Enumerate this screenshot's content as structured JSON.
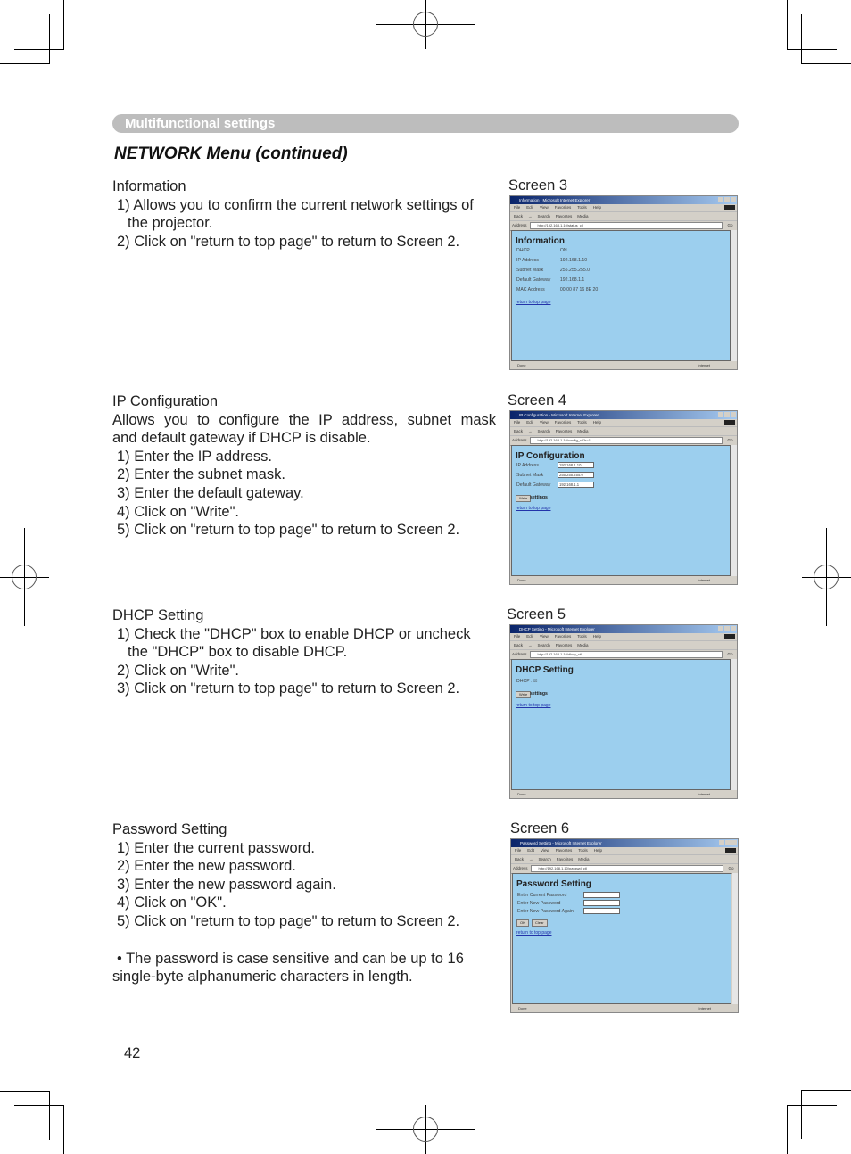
{
  "header": {
    "section": "Multifunctional settings",
    "title": "NETWORK Menu (continued)"
  },
  "sections": [
    {
      "heading": "Information",
      "lines": [
        "1) Allows you to confirm the current network settings of",
        "the projector.",
        "2) Click on \"return to top page\" to return to Screen 2."
      ],
      "screen_label": "Screen 3"
    },
    {
      "heading": "IP Configuration",
      "lines": [
        "Allows you to configure the IP address, subnet mask",
        "and default gateway if DHCP is disable.",
        "1) Enter the IP address.",
        "2) Enter the subnet mask.",
        "3) Enter the default gateway.",
        "4) Click on \"Write\".",
        "5) Click on \"return to top page\" to return to Screen 2."
      ],
      "screen_label": "Screen 4"
    },
    {
      "heading": "DHCP Setting",
      "lines": [
        "1) Check the \"DHCP\" box to enable DHCP or uncheck",
        "the \"DHCP\" box to disable DHCP.",
        "2) Click on \"Write\".",
        "3) Click on \"return to top page\" to return to Screen 2."
      ],
      "screen_label": "Screen 5"
    },
    {
      "heading": "Password Setting",
      "lines": [
        "1) Enter the current password.",
        "2) Enter the new password.",
        "3) Enter the new password again.",
        "4) Click on \"OK\".",
        "5) Click on \"return to top page\" to return to Screen 2."
      ],
      "note": [
        "• The password is case sensitive and can be up to 16",
        "single-byte alphanumeric characters in length."
      ],
      "screen_label": "Screen 6"
    }
  ],
  "browser": {
    "menu": [
      "File",
      "Edit",
      "View",
      "Favorites",
      "Tools",
      "Help"
    ],
    "toolbar": [
      "Back",
      "→",
      "Search",
      "Favorites",
      "Media"
    ],
    "address_label": "Address",
    "go_label": "Go",
    "status_done": "Done",
    "status_zone": "Internet",
    "return_link": "return to top page"
  },
  "screens": {
    "info": {
      "window_title": "Information - Microsoft Internet Explorer",
      "address": "http://192.168.1.10/status_ctl",
      "page_title": "Information",
      "rows": [
        {
          "key": "DHCP",
          "value": ": ON"
        },
        {
          "key": "IP Address",
          "value": ": 192.168.1.10"
        },
        {
          "key": "Subnet Mask",
          "value": ": 255.255.255.0"
        },
        {
          "key": "Default Gateway",
          "value": ": 192.168.1.1"
        },
        {
          "key": "MAC Address",
          "value": ": 00 00 87 16 8E 20"
        }
      ]
    },
    "ipconfig": {
      "window_title": "IP Configuration - Microsoft Internet Explorer",
      "address": "http://192.168.1.10/config_ctl?r=1",
      "page_title": "IP Configuration",
      "rows": [
        {
          "key": "IP Address",
          "value": "192.168.1.10"
        },
        {
          "key": "Subnet Mask",
          "value": "255.255.255.0"
        },
        {
          "key": "Default Gateway",
          "value": "192.168.1.1"
        }
      ],
      "write_button": "Write",
      "settings_label": "settings"
    },
    "dhcp": {
      "window_title": "DHCP Setting - Microsoft Internet Explorer",
      "address": "http://192.168.1.10/dhcp_ctl",
      "page_title": "DHCP Setting",
      "dhcp_label": "DHCP :",
      "dhcp_checked": true,
      "write_button": "Write",
      "settings_label": "settings"
    },
    "password": {
      "window_title": "Password Setting - Microsoft Internet Explorer",
      "address": "http://192.168.1.10/passwd_ctl",
      "page_title": "Password Setting",
      "rows": [
        {
          "key": "Enter Current Password",
          "value": ""
        },
        {
          "key": "Enter New Password",
          "value": ""
        },
        {
          "key": "Enter New Password Again",
          "value": ""
        }
      ],
      "ok_button": "OK",
      "clear_button": "Clear"
    }
  },
  "page_number": "42"
}
